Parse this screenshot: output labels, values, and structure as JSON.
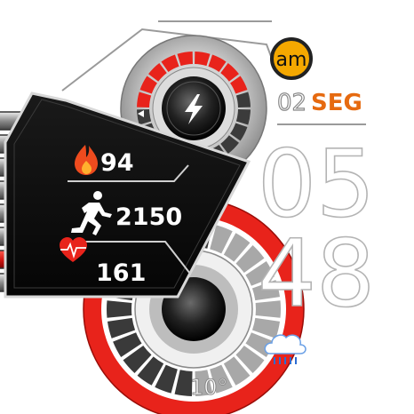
{
  "watch": {
    "ampm": "am",
    "day": "02",
    "weekday": "SEG",
    "hour": "05",
    "minute": "48",
    "temperature": "10°"
  },
  "stats": {
    "calories": "94",
    "steps": "2150",
    "heart_rate": "161"
  },
  "battery_gauge": {
    "level_fraction": 0.45,
    "segments": 20,
    "icon": "lightning-bolt-icon"
  },
  "lower_gauge": {
    "level_fraction": 0.55,
    "segments": 26
  },
  "left_bar_stack": {
    "count": 8,
    "active_index": 6
  },
  "icons": {
    "calories": "flame-icon",
    "steps": "running-person-icon",
    "heart_rate": "heart-pulse-icon",
    "weather": "cloud-rain-icon"
  },
  "colors": {
    "accent_red": "#e8231b",
    "accent_orange": "#e66a10",
    "amber_badge": "#f5a800",
    "panel_dark": "#111111",
    "digit_outline": "#bbbbbb",
    "weather_blue": "#2d6cd2"
  }
}
